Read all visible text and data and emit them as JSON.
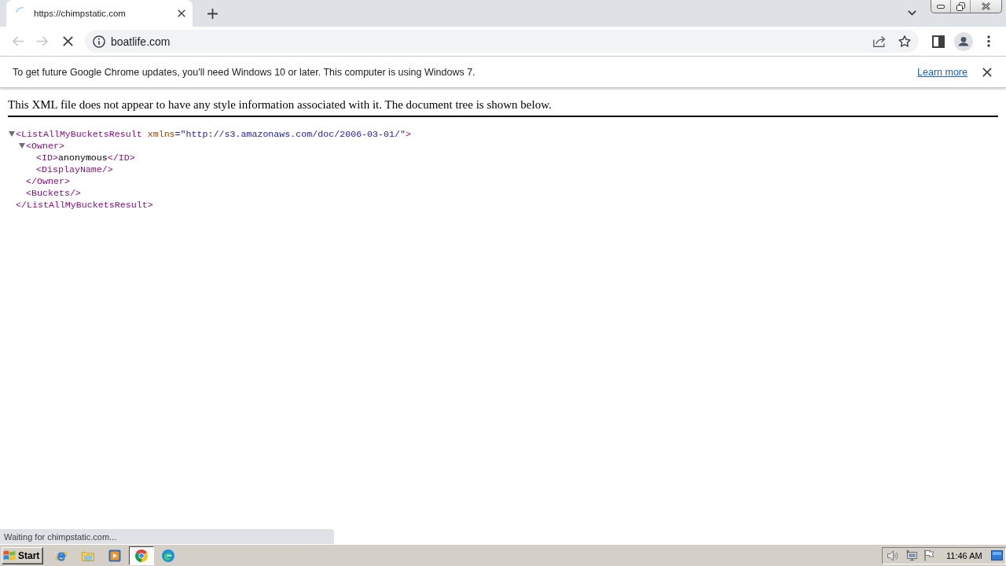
{
  "tab_strip": {
    "tabs": [
      {
        "title": "https://chimpstatic.com",
        "selected": true,
        "loading": true
      }
    ]
  },
  "toolbar": {
    "back": {
      "disabled": true
    },
    "forward": {
      "disabled": true
    },
    "loading": true,
    "address": "boatlife.com"
  },
  "infobar": {
    "message": "To get future Google Chrome updates, you'll need Windows 10 or later. This computer is using Windows 7.",
    "link": "Learn more"
  },
  "xml_viewer": {
    "notice": "This XML file does not appear to have any style information associated with it. The document tree is shown below.",
    "tree": [
      {
        "tag": "<ListAllMyBucketsResult",
        "attribute_name": "xmlns",
        "attribute_value": "=\"http://s3.amazonaws.com/doc/2006-03-01/\"",
        "tag_end": ">",
        "expanded": true,
        "children": [
          {
            "tag": "<Owner>",
            "expanded": true,
            "children": [
              {
                "tag": "<ID>",
                "text": "anonymous",
                "closing_tag": "</ID>"
              },
              {
                "tag": "<DisplayName/>"
              }
            ],
            "closing_tag": "</Owner>"
          },
          {
            "tag": "<Buckets/>"
          }
        ],
        "closing_tag": "</ListAllMyBucketsResult>"
      }
    ]
  },
  "status_bubble": "Waiting for chimpstatic.com...",
  "taskbar": {
    "start": "Start",
    "apps": [
      {
        "kind": "e-globe",
        "selected": false
      },
      {
        "kind": "folder",
        "selected": false
      },
      {
        "kind": "media",
        "selected": false
      },
      {
        "kind": "wheel",
        "selected": true
      },
      {
        "kind": "swirl",
        "selected": false
      }
    ],
    "clock": "11:46 AM"
  }
}
